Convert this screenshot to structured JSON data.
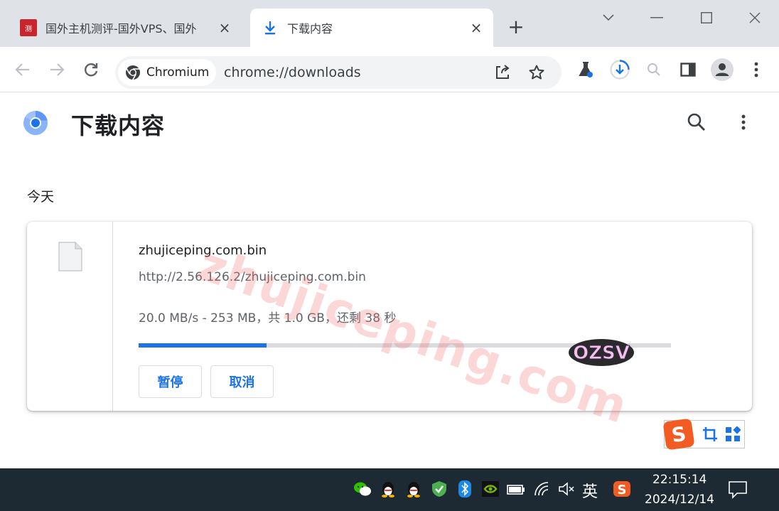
{
  "tabs": [
    {
      "title": "国外主机测评-国外VPS、国外",
      "favicon_text": "测",
      "close": "×"
    },
    {
      "title": "下载内容",
      "close": "×"
    }
  ],
  "new_tab": "+",
  "omnibox": {
    "chip_label": "Chromium",
    "url": "chrome://downloads"
  },
  "page": {
    "title": "下载内容",
    "date_group": "今天"
  },
  "download": {
    "file_name": "zhujiceping.com.bin",
    "source_url": "http://2.56.126.2/zhujiceping.com.bin",
    "status": "20.0 MB/s - 253 MB，共 1.0 GB，还剩 38 秒",
    "progress_fraction": 0.24,
    "pause_label": "暂停",
    "cancel_label": "取消"
  },
  "watermark": {
    "text": "zhujiceping.com",
    "sticker": "OZSV"
  },
  "ime": {
    "logo": "S"
  },
  "taskbar": {
    "ime_lang": "英",
    "time": "22:15:14",
    "date": "2024/12/14"
  },
  "colors": {
    "accent": "#1a73e8",
    "tabstrip": "#dfe3e8",
    "taskbar": "#1e2a33"
  }
}
